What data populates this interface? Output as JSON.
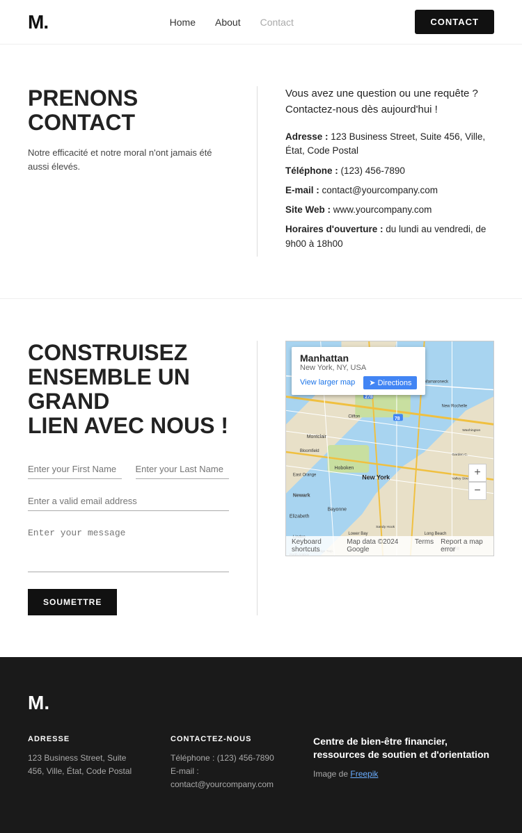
{
  "header": {
    "logo": "M.",
    "nav": [
      {
        "label": "Home",
        "active": false
      },
      {
        "label": "About",
        "active": false
      },
      {
        "label": "Contact",
        "active": true
      }
    ],
    "cta_label": "CONTACT"
  },
  "section1": {
    "heading": "PRENONS CONTACT",
    "subtext": "Notre efficacité et notre moral n'ont jamais été aussi élevés.",
    "intro": "Vous avez une question ou une requête ? Contactez-nous dès aujourd'hui !",
    "address_label": "Adresse :",
    "address_value": "123 Business Street, Suite 456, Ville, État, Code Postal",
    "phone_label": "Téléphone :",
    "phone_value": "(123) 456-7890",
    "email_label": "E-mail :",
    "email_value": "contact@yourcompany.com",
    "web_label": "Site Web :",
    "web_value": "www.yourcompany.com",
    "hours_label": "Horaires d'ouverture :",
    "hours_value": "du lundi au vendredi, de 9h00 à 18h00"
  },
  "section2": {
    "heading_line1": "CONSTRUISEZ",
    "heading_line2": "ENSEMBLE UN GRAND",
    "heading_line3": "LIEN AVEC NOUS !",
    "form": {
      "first_name_placeholder": "Enter your First Name",
      "last_name_placeholder": "Enter your Last Name",
      "email_placeholder": "Enter a valid email address",
      "message_placeholder": "Enter your message",
      "submit_label": "SOUMETTRE"
    },
    "map": {
      "place_name": "Manhattan",
      "place_sub": "New York, NY, USA",
      "view_larger": "View larger map",
      "directions": "Directions",
      "footer_items": [
        "Keyboard shortcuts",
        "Map data ©2024 Google",
        "Terms",
        "Report a map error"
      ]
    }
  },
  "footer": {
    "logo": "M.",
    "address_heading": "ADRESSE",
    "address_value": "123 Business Street, Suite 456, Ville, État, Code Postal",
    "contact_heading": "CONTACTEZ-NOUS",
    "phone": "Téléphone : (123) 456-7890",
    "email": "E-mail : contact@yourcompany.com",
    "right_heading": "Centre de bien-être financier, ressources de soutien et d'orientation",
    "right_text": "Image de ",
    "right_link_text": "Freepik"
  }
}
